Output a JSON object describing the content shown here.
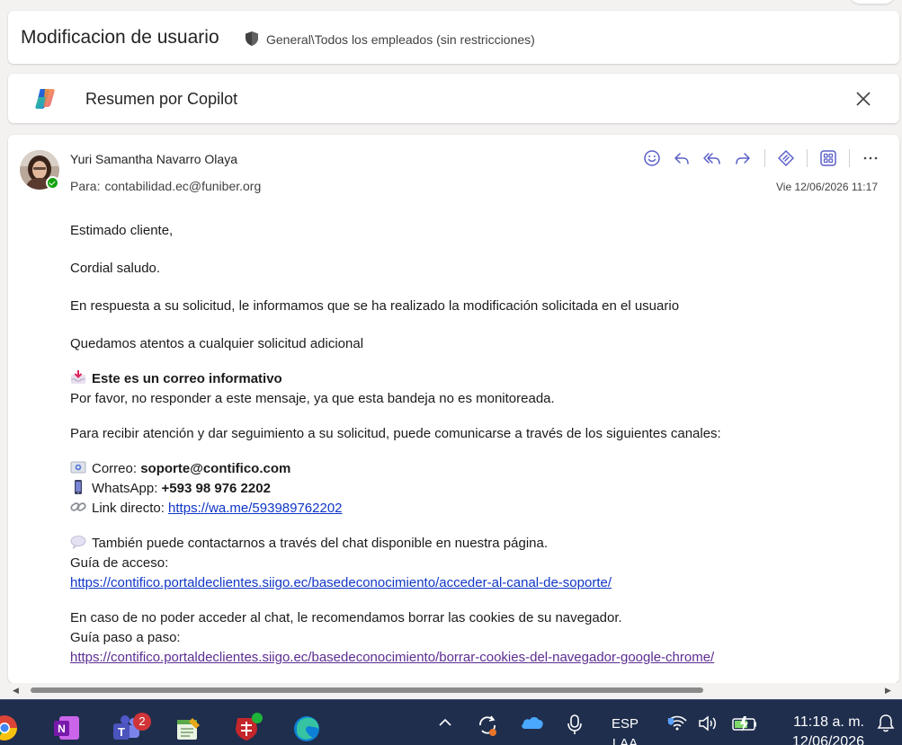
{
  "message": {
    "subject": "Modificacion de usuario",
    "sensitivity": "General\\Todos los empleados (sin restricciones)",
    "sender_name": "Yuri Samantha Navarro Olaya",
    "to_label": "Para:",
    "to_address": "contabilidad.ec@funiber.org",
    "date": "Vie 12/06/2026 11:17"
  },
  "copilot": {
    "title": "Resumen por Copilot"
  },
  "actions": [
    "smile-icon",
    "reply-icon",
    "reply-all-icon",
    "forward-icon",
    "loop-icon",
    "apps-icon",
    "more-icon"
  ],
  "body": {
    "greeting": "Estimado cliente,",
    "salutation": "Cordial saludo.",
    "p1": "En respuesta a su solicitud, le informamos que se ha realizado la modificación solicitada en el usuario",
    "p2": "Quedamos atentos a cualquier solicitud adicional",
    "info_title": "Este es un correo informativo",
    "info_text": "Por favor, no responder a este mensaje, ya que esta bandeja no es monitoreada.",
    "channels_intro": "Para recibir atención y dar seguimiento a su solicitud, puede comunicarse a través de los siguientes canales:",
    "email_label": "Correo:",
    "email_value": "soporte@contifico.com",
    "whatsapp_label": "WhatsApp:",
    "whatsapp_value": "+593 98 976 2202",
    "link_label": "Link directo:",
    "link_value": "https://wa.me/593989762202",
    "chat_text": "También puede contactarnos a través del chat disponible en nuestra página.",
    "guide_label": "Guía de acceso:",
    "guide_url": "https://contifico.portaldeclientes.siigo.ec/basedeconocimiento/acceder-al-canal-de-soporte/",
    "cookies_text": "En caso de no poder acceder al chat, le recomendamos borrar las cookies de su navegador.",
    "step_label": "Guía paso a paso:",
    "step_url": "https://contifico.portaldeclientes.siigo.ec/basedeconocimiento/borrar-cookies-del-navegador-google-chrome/"
  },
  "taskbar": {
    "teams_badge": "2",
    "lang_top": "ESP",
    "lang_bottom": "LAA",
    "time": "11:18 a. m.",
    "date": "12/06/2026"
  },
  "colors": {
    "accent": "#5b5fc7",
    "link": "#0f36c7",
    "visited_link": "#5c2d91",
    "taskbar": "#1f2e4d"
  }
}
